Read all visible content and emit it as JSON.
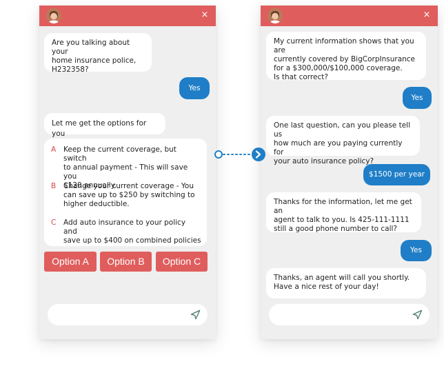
{
  "left_chat": {
    "close_glyph": "×",
    "messages": [
      {
        "from": "bot",
        "text": "Are you talking about your\nhome insurance police,\nH232358?"
      },
      {
        "from": "user",
        "text": "Yes"
      },
      {
        "from": "bot",
        "text": "Let me get the options for you"
      }
    ],
    "options": [
      {
        "letter": "A",
        "text": "Keep the current coverage, but switch\nto annual payment - This will save you\n$120 annually."
      },
      {
        "letter": "B",
        "text": "Change your current coverage - You\ncan save up to $250 by switching to\nhigher deductible."
      },
      {
        "letter": "C",
        "text": "Add auto insurance to your policy and\nsave up to $400 on combined policies"
      }
    ],
    "buttons": [
      "Option A",
      "Option B",
      "Option C"
    ],
    "input_placeholder": ""
  },
  "right_chat": {
    "close_glyph": "×",
    "messages": [
      {
        "from": "bot",
        "text": "My current information shows that you are\ncurrently covered by BigCorpInsurance\nfor a $300,000/$100,000 coverage.\nIs that correct?"
      },
      {
        "from": "user",
        "text": "Yes"
      },
      {
        "from": "bot",
        "text": "One last question, can you please tell us\nhow much are you paying currently for\nyour auto insurance policy?"
      },
      {
        "from": "user",
        "text": "$1500 per year"
      },
      {
        "from": "bot",
        "text": "Thanks for the information, let me get an\nagent to talk to you. Is 425-111-1111\nstill a good phone number to call?"
      },
      {
        "from": "user",
        "text": "Yes"
      },
      {
        "from": "bot",
        "text": "Thanks, an agent will call you shortly.\nHave a nice rest of your day!"
      }
    ],
    "input_placeholder": ""
  },
  "colors": {
    "header": "#e05d5d",
    "user_bubble": "#1f7ec7",
    "option_button": "#e05d5d",
    "option_letter": "#d94646",
    "connector": "#1f7ec7"
  },
  "icons": [
    "avatar",
    "close-icon",
    "send-icon",
    "chevron-right-icon"
  ]
}
